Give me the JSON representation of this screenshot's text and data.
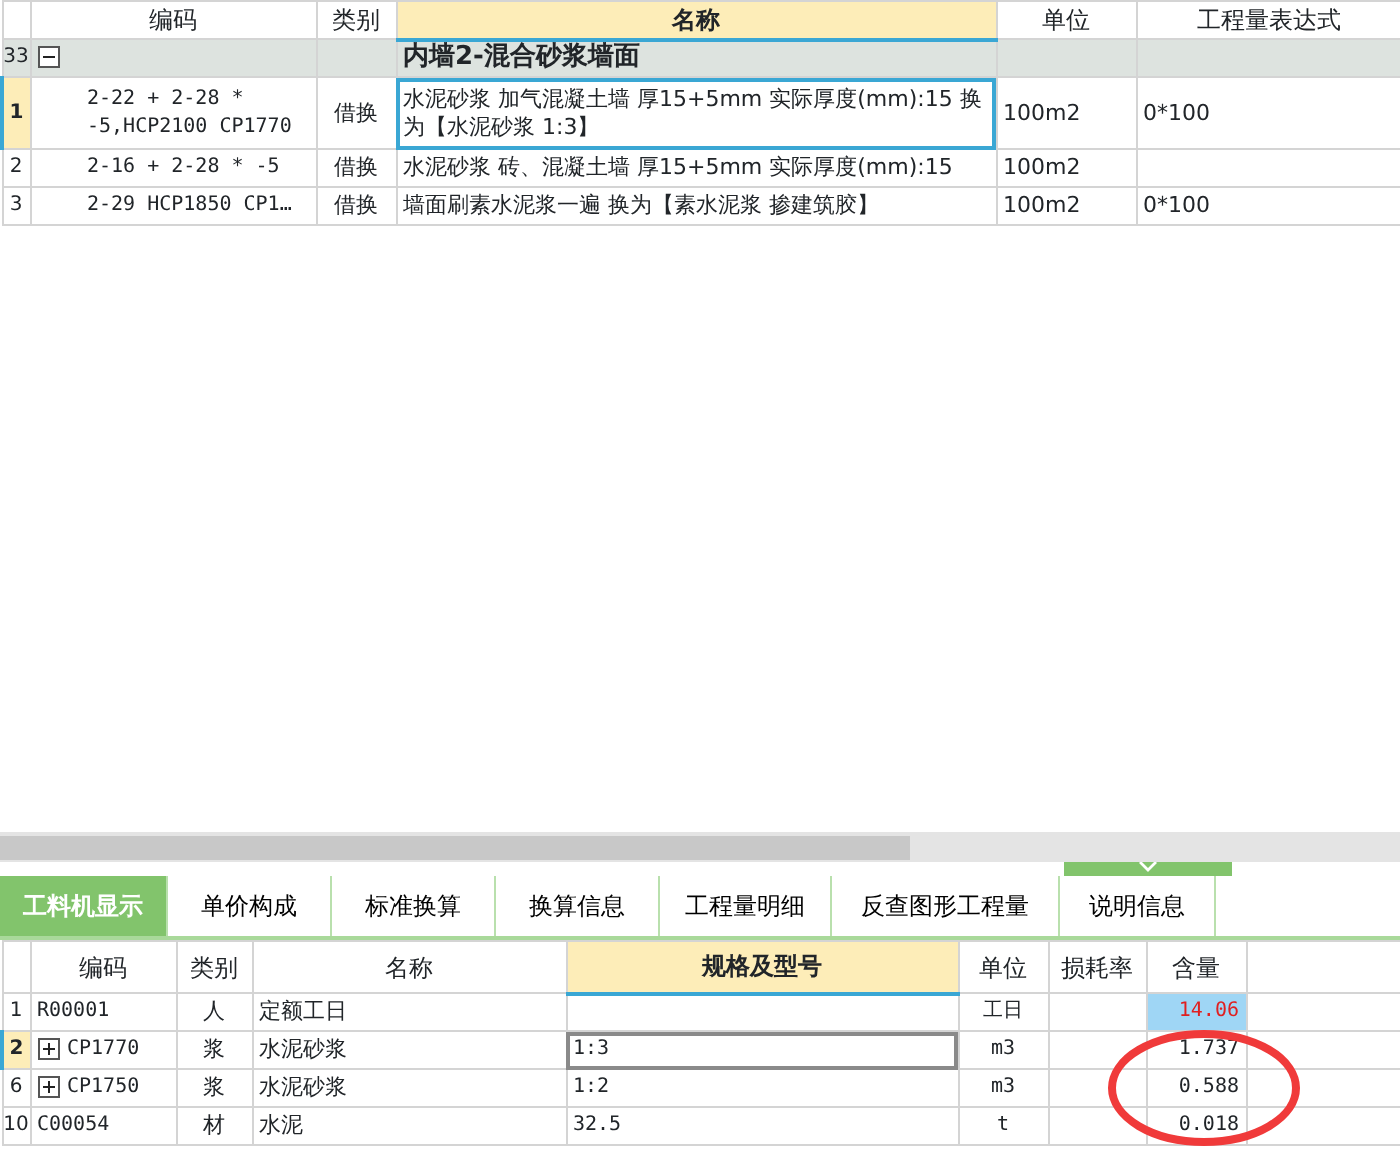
{
  "top_table": {
    "columns": [
      {
        "label": "编码",
        "selected": false
      },
      {
        "label": "类别",
        "selected": false
      },
      {
        "label": "名称",
        "selected": true
      },
      {
        "label": "单位",
        "selected": false
      },
      {
        "label": "工程量表达式",
        "selected": false
      }
    ],
    "group": {
      "number": "33",
      "name": "内墙2-混合砂浆墙面",
      "expanded": true
    },
    "rows": [
      {
        "number": "1",
        "code": "2-22 + 2-28 * -5,HCP2100 CP1770",
        "type": "借换",
        "name": "水泥砂浆 加气混凝土墙 厚15+5mm  实际厚度(mm):15 换为【水泥砂浆 1:3】",
        "unit": "100m2",
        "expr": "0*100",
        "selected": true
      },
      {
        "number": "2",
        "code": "2-16 + 2-28 * -5",
        "type": "借换",
        "name": "水泥砂浆 砖、混凝土墙 厚15+5mm  实际厚度(mm):15",
        "unit": "100m2",
        "expr": "",
        "selected": false
      },
      {
        "number": "3",
        "code": "2-29 HCP1850 CP1…",
        "type": "借换",
        "name": "墙面刷素水泥浆一遍  换为【素水泥浆 掺建筑胶】",
        "unit": "100m2",
        "expr": "0*100",
        "selected": false
      }
    ]
  },
  "tabs": [
    {
      "label": "工料机显示",
      "selected": true
    },
    {
      "label": "单价构成",
      "selected": false
    },
    {
      "label": "标准换算",
      "selected": false
    },
    {
      "label": "换算信息",
      "selected": false
    },
    {
      "label": "工程量明细",
      "selected": false
    },
    {
      "label": "反查图形工程量",
      "selected": false
    },
    {
      "label": "说明信息",
      "selected": false
    }
  ],
  "bottom_table": {
    "columns": [
      {
        "label": "编码",
        "selected": false
      },
      {
        "label": "类别",
        "selected": false
      },
      {
        "label": "名称",
        "selected": false
      },
      {
        "label": "规格及型号",
        "selected": true
      },
      {
        "label": "单位",
        "selected": false
      },
      {
        "label": "损耗率",
        "selected": false
      },
      {
        "label": "含量",
        "selected": false
      }
    ],
    "rows": [
      {
        "number": "1",
        "kind": "item",
        "code": "R00001",
        "type": "人",
        "name": "定额工日",
        "spec": "",
        "unit": "工日",
        "loss": "",
        "amount": "14.06",
        "selected": false
      },
      {
        "number": "2",
        "kind": "group",
        "code": "CP1770",
        "type": "浆",
        "name": "水泥砂浆",
        "spec": "1:3",
        "unit": "m3",
        "loss": "",
        "amount": "1.737",
        "selected": true
      },
      {
        "number": "6",
        "kind": "group",
        "code": "CP1750",
        "type": "浆",
        "name": "水泥砂浆",
        "spec": "1:2",
        "unit": "m3",
        "loss": "",
        "amount": "0.588",
        "selected": false
      },
      {
        "number": "10",
        "kind": "item",
        "code": "C00054",
        "type": "材",
        "name": "水泥",
        "spec": "32.5",
        "unit": "t",
        "loss": "",
        "amount": "0.018",
        "selected": false
      }
    ]
  }
}
